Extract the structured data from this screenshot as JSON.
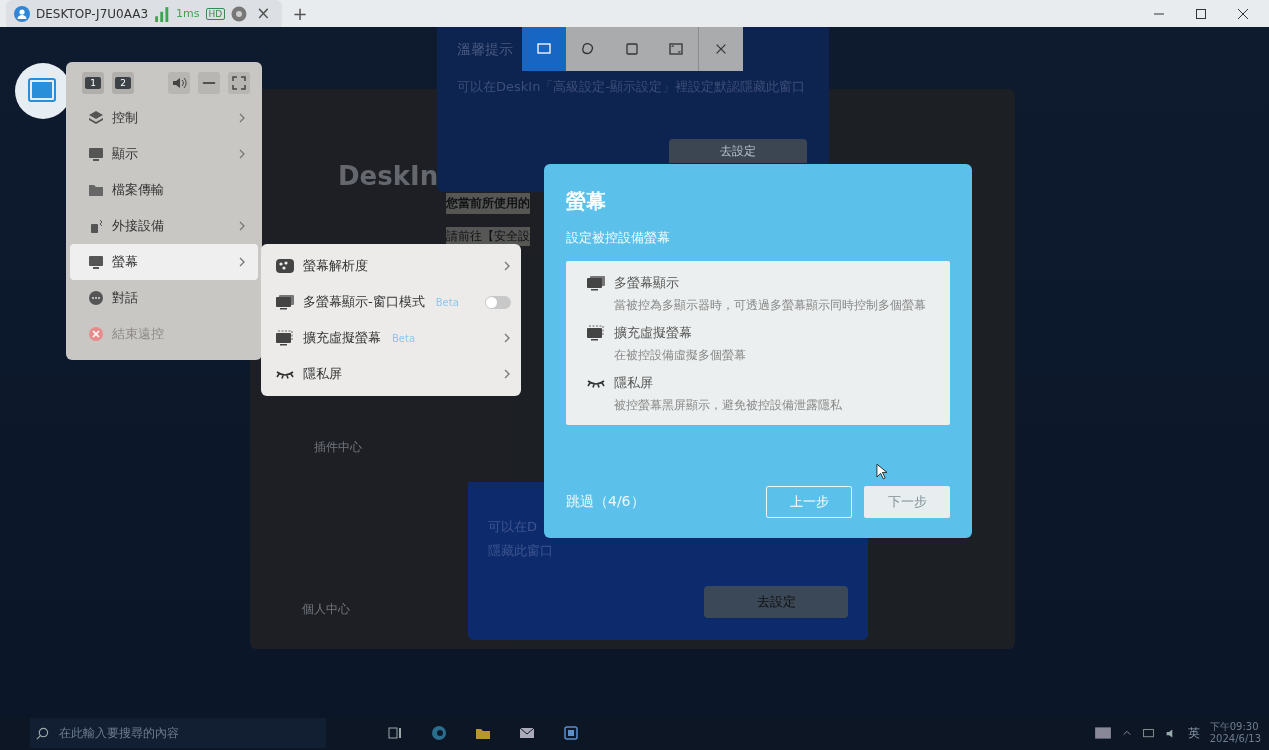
{
  "tab_bar": {
    "title": "DESKTOP-J7U0AA3",
    "latency": "1ms",
    "quality_badge": "HD",
    "close": "×",
    "add": "+"
  },
  "background": {
    "notice_title": "溫馨提示",
    "notice_text": "可以在DeskIn「高級設定-顯示設定」裡設定默認隱藏此窗口",
    "notice_button": "去設定",
    "app_logo": "DeskIn",
    "app_line_1": "您當前所使用的",
    "app_line_2": "請前往【安全設",
    "app_plugin": "插件中心",
    "app_profile": "個人中心",
    "lower_text_1": "可以在D",
    "lower_text_2": "隱藏此窗口",
    "lower_button": "去設定"
  },
  "snip_toolbar": {
    "tools": [
      {
        "kind": "rect",
        "selected": true
      },
      {
        "kind": "freeform",
        "selected": false
      },
      {
        "kind": "window",
        "selected": false
      },
      {
        "kind": "fullscreen",
        "selected": false
      }
    ]
  },
  "floating_menu": {
    "quick": [
      {
        "kind": "monitor",
        "label": "1"
      },
      {
        "kind": "monitor",
        "label": "2"
      },
      {
        "kind": "speaker"
      },
      {
        "kind": "minimize"
      },
      {
        "kind": "fullscreen"
      }
    ],
    "items": [
      {
        "label": "控制",
        "submenu": true,
        "selected": false,
        "disabled": false
      },
      {
        "label": "顯示",
        "submenu": true,
        "selected": false,
        "disabled": false
      },
      {
        "label": "檔案傳輸",
        "submenu": false,
        "selected": false,
        "disabled": false
      },
      {
        "label": "外接設備",
        "submenu": true,
        "selected": false,
        "disabled": false
      },
      {
        "label": "螢幕",
        "submenu": true,
        "selected": true,
        "disabled": false
      },
      {
        "label": "對話",
        "submenu": false,
        "selected": false,
        "disabled": false
      },
      {
        "label": "結束遠控",
        "submenu": false,
        "selected": false,
        "disabled": true
      }
    ]
  },
  "submenu": {
    "items": [
      {
        "kind": "submenu",
        "label": "螢幕解析度"
      },
      {
        "kind": "toggle",
        "label": "多螢幕顯示-窗口模式",
        "badge": "Beta",
        "on": false
      },
      {
        "kind": "submenu",
        "label": "擴充虛擬螢幕",
        "badge": "Beta"
      },
      {
        "kind": "submenu",
        "label": "隱私屏"
      }
    ]
  },
  "guide": {
    "title": "螢幕",
    "subtitle": "設定被控設備螢幕",
    "features": [
      {
        "title": "多螢幕顯示",
        "description": "當被控為多顯示器時，可透過多螢幕顯示同時控制多個螢幕"
      },
      {
        "title": "擴充虛擬螢幕",
        "description": "在被控設備虛擬多個螢幕"
      },
      {
        "title": "隱私屏",
        "description": "被控螢幕黑屏顯示，避免被控設備泄露隱私"
      }
    ],
    "progress": "跳過（4/6）",
    "buttons": [
      {
        "label": "上一步",
        "disabled": false
      },
      {
        "label": "下一步",
        "disabled": true
      }
    ]
  },
  "taskbar": {
    "search_placeholder": "在此輸入要搜尋的內容",
    "ime": "英",
    "time": "下午09:30",
    "date": "2024/6/13"
  }
}
